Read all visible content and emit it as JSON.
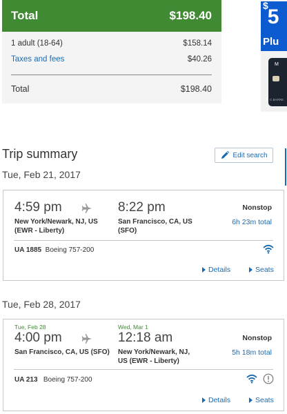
{
  "price_summary": {
    "header_label": "Total",
    "header_amount": "$198.40",
    "rows": [
      {
        "label": "1 adult (18-64)",
        "amount": "$158.14"
      },
      {
        "label": "Taxes and fees",
        "amount": "$40.26"
      }
    ],
    "total_label": "Total",
    "total_amount": "$198.40"
  },
  "ad": {
    "currency": "$",
    "amount": "5",
    "line2": "Plu",
    "card_text": "M",
    "card_name": "C BARRE"
  },
  "trip": {
    "title": "Trip summary",
    "edit_label": "Edit search"
  },
  "flights": [
    {
      "date_heading": "Tue, Feb 21, 2017",
      "depart_day": "",
      "arrive_day": "",
      "depart_time": "4:59 pm",
      "arrive_time": "8:22 pm",
      "depart_place_1": "New York/Newark, NJ, US",
      "depart_place_2": "(EWR - Liberty)",
      "arrive_place_1": "San Francisco, CA, US",
      "arrive_place_2": "(SFO)",
      "stops": "Nonstop",
      "duration": "6h 23m total",
      "flight_number": "UA 1885",
      "aircraft": "Boeing 757-200",
      "details_label": "Details",
      "seats_label": "Seats"
    },
    {
      "date_heading": "Tue, Feb 28, 2017",
      "depart_day": "Tue, Feb 28",
      "arrive_day": "Wed, Mar 1",
      "depart_time": "4:00 pm",
      "arrive_time": "12:18 am",
      "depart_place_1": "San Francisco, CA, US (SFO)",
      "depart_place_2": "",
      "arrive_place_1": "New York/Newark, NJ,",
      "arrive_place_2": "US (EWR - Liberty)",
      "stops": "Nonstop",
      "duration": "5h 18m total",
      "flight_number": "UA 213",
      "aircraft": "Boeing 757-200",
      "details_label": "Details",
      "seats_label": "Seats"
    }
  ],
  "colors": {
    "header_green": "#3f8a33",
    "link_blue": "#1a6ab0",
    "ad_blue": "#0d5bd1"
  }
}
